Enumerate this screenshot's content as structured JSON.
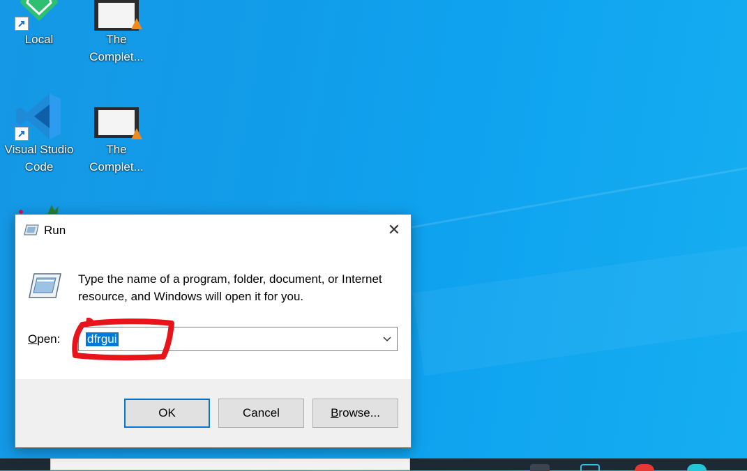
{
  "desktop": {
    "icons": [
      {
        "label": "Local"
      },
      {
        "label": "The Complet..."
      },
      {
        "label": "Visual Studio Code"
      },
      {
        "label": "The Complet..."
      }
    ]
  },
  "run_dialog": {
    "title": "Run",
    "description": "Type the name of a program, folder, document, or Internet resource, and Windows will open it for you.",
    "open_label_prefix": "O",
    "open_label_rest": "pen:",
    "open_value": "dfrgui",
    "ok_label": "OK",
    "cancel_label": "Cancel",
    "browse_label_prefix": "B",
    "browse_label_rest": "rowse...",
    "close_glyph": "✕"
  },
  "colors": {
    "accent": "#0078d7",
    "annotation": "#e8141c"
  }
}
